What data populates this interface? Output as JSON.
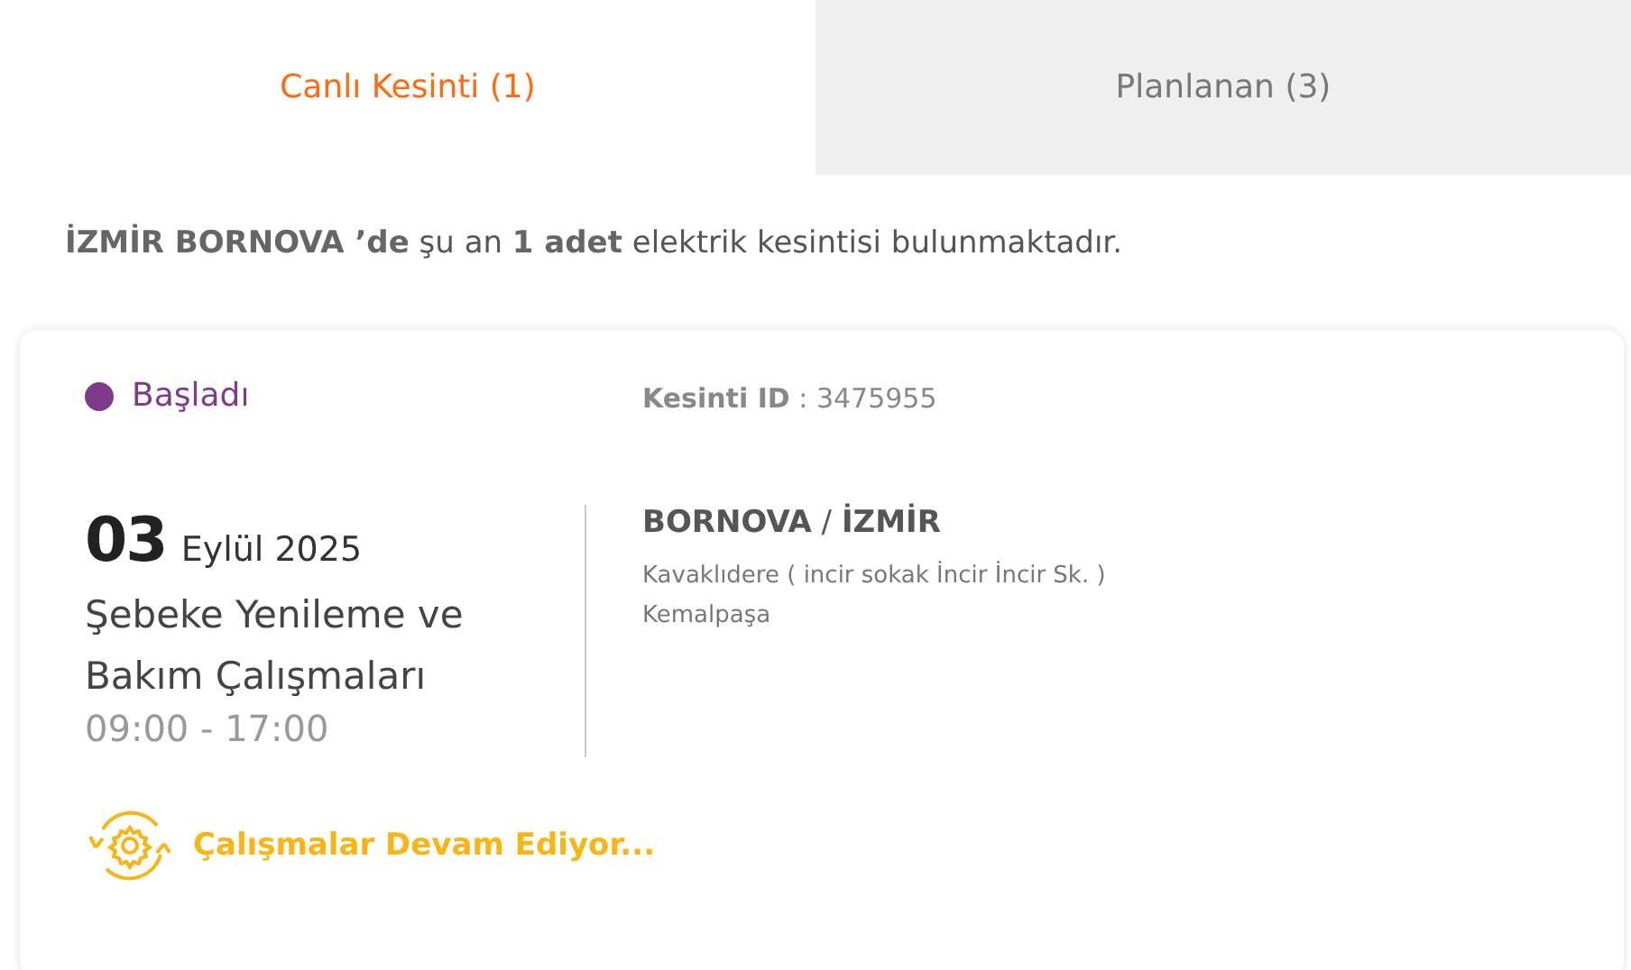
{
  "tabs": [
    {
      "label": "Canlı Kesinti (1)",
      "selected": true
    },
    {
      "label": "Planlanan (3)",
      "selected": false
    }
  ],
  "summary": "**İZMİR BORNOVA ’de** şu an **1 adet** elektrik kesintisi bulunmaktadır.",
  "outage": {
    "status": {
      "label": "Başladı",
      "color": "#7d3b8a"
    },
    "outage_id": "**Kesinti ID** : 3475955",
    "day": "03",
    "month_year": "Eylül 2025",
    "title": "Şebeke Yenileme ve Bakım Çalışmaları",
    "time": "09:00 - 17:00",
    "location": "**BORNOVA** / **İZMİR**",
    "address_lines": [
      "Kavaklıdere ( incir sokak İncir İncir Sk. )",
      "Kemalpaşa"
    ],
    "progress": "Çalışmalar Devam Ediyor..."
  }
}
